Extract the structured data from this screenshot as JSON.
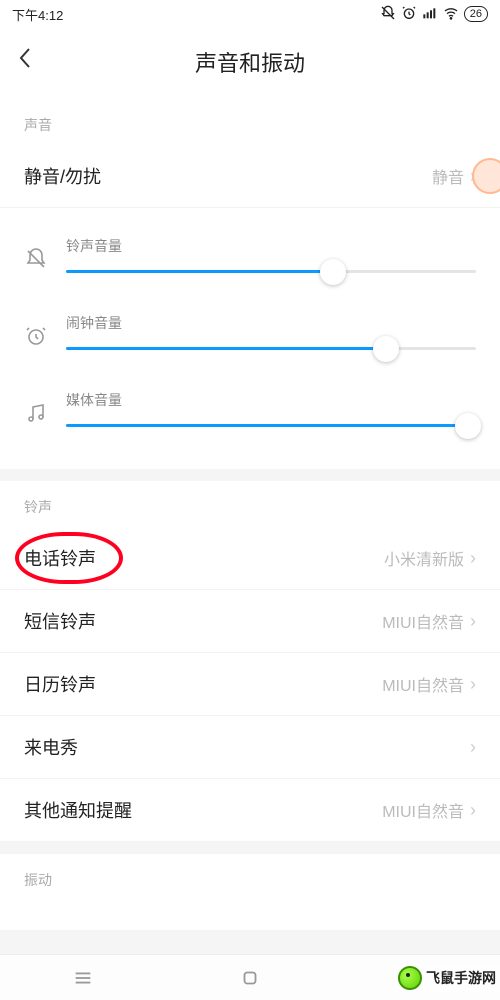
{
  "status": {
    "time": "下午4:12",
    "battery": "26"
  },
  "header": {
    "title": "声音和振动"
  },
  "sections": {
    "sound_label": "声音",
    "ringtone_label": "铃声",
    "vibration_label": "振动"
  },
  "silent_row": {
    "label": "静音/勿扰",
    "value": "静音"
  },
  "sliders": {
    "ringer": {
      "label": "铃声音量",
      "percent": 65
    },
    "alarm": {
      "label": "闹钟音量",
      "percent": 78
    },
    "media": {
      "label": "媒体音量",
      "percent": 98
    }
  },
  "ringtone_rows": {
    "phone": {
      "label": "电话铃声",
      "value": "小米清新版"
    },
    "sms": {
      "label": "短信铃声",
      "value": "MIUI自然音"
    },
    "calendar": {
      "label": "日历铃声",
      "value": "MIUI自然音"
    },
    "call_show": {
      "label": "来电秀",
      "value": ""
    },
    "other_notify": {
      "label": "其他通知提醒",
      "value": "MIUI自然音"
    }
  },
  "watermark": "飞鼠手游网"
}
